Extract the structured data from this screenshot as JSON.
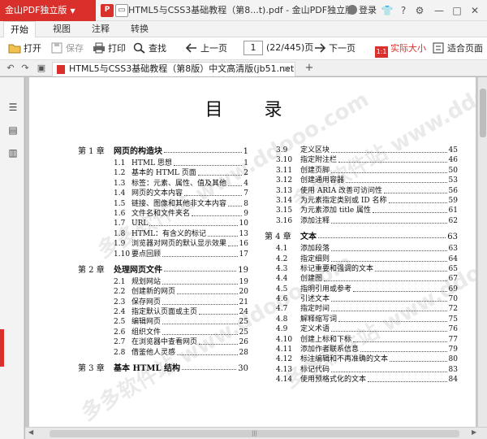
{
  "app": {
    "logo_label": "金山PDF独立版",
    "window_title": "HTML5与CSS3基础教程（第8...t).pdf - 金山PDF独立版",
    "login_label": "登录"
  },
  "menu": [
    "开始",
    "视图",
    "注释",
    "转换"
  ],
  "toolbar": {
    "open": "打开",
    "save": "保存",
    "print": "打印",
    "find": "查找",
    "prev_page": "上一页",
    "page_value": "1",
    "page_count": "(22/445)页",
    "next_page": "下一页",
    "actual_size": "实际大小",
    "fit_page": "适合页面"
  },
  "doc_tab": {
    "label": "HTML5与CSS3基础教程（第8版）中文高清版(jb51.net).pdf"
  },
  "page": {
    "title": "目 录",
    "watermark": "多多软件站 www.ddooo.com",
    "left_column": [
      {
        "type": "chapter",
        "num": "第 1 章",
        "text": "网页的构造块",
        "page": "1"
      },
      {
        "type": "entry",
        "num": "1.1",
        "text": "HTML 思想",
        "page": "1"
      },
      {
        "type": "entry",
        "num": "1.2",
        "text": "基本的 HTML 页面",
        "page": "2"
      },
      {
        "type": "entry",
        "num": "1.3",
        "text": "标签：元素、属性、值及其他",
        "page": "4"
      },
      {
        "type": "entry",
        "num": "1.4",
        "text": "网页的文本内容",
        "page": "7"
      },
      {
        "type": "entry",
        "num": "1.5",
        "text": "链接、图像和其他非文本内容",
        "page": "8"
      },
      {
        "type": "entry",
        "num": "1.6",
        "text": "文件名和文件夹名",
        "page": "9"
      },
      {
        "type": "entry",
        "num": "1.7",
        "text": "URL",
        "page": "10"
      },
      {
        "type": "entry",
        "num": "1.8",
        "text": "HTML：有含义的标记",
        "page": "13"
      },
      {
        "type": "entry",
        "num": "1.9",
        "text": "浏览器对网页的默认显示效果",
        "page": "16"
      },
      {
        "type": "entry",
        "num": "1.10",
        "text": "要点回顾",
        "page": "17"
      },
      {
        "type": "chapter",
        "num": "第 2 章",
        "text": "处理网页文件",
        "page": "19"
      },
      {
        "type": "entry",
        "num": "2.1",
        "text": "规划网站",
        "page": "19"
      },
      {
        "type": "entry",
        "num": "2.2",
        "text": "创建新的网页",
        "page": "20"
      },
      {
        "type": "entry",
        "num": "2.3",
        "text": "保存网页",
        "page": "21"
      },
      {
        "type": "entry",
        "num": "2.4",
        "text": "指定默认页面或主页",
        "page": "24"
      },
      {
        "type": "entry",
        "num": "2.5",
        "text": "编辑网页",
        "page": "25"
      },
      {
        "type": "entry",
        "num": "2.6",
        "text": "组织文件",
        "page": "25"
      },
      {
        "type": "entry",
        "num": "2.7",
        "text": "在浏览器中查看网页",
        "page": "26"
      },
      {
        "type": "entry",
        "num": "2.8",
        "text": "借鉴他人灵感",
        "page": "28"
      },
      {
        "type": "chapter",
        "num": "第 3 章",
        "text": "基本 HTML 结构",
        "page": "30"
      }
    ],
    "right_column": [
      {
        "type": "entry",
        "num": "3.9",
        "text": "定义区块",
        "page": "45"
      },
      {
        "type": "entry",
        "num": "3.10",
        "text": "指定附注栏",
        "page": "46"
      },
      {
        "type": "entry",
        "num": "3.11",
        "text": "创建页脚",
        "page": "50"
      },
      {
        "type": "entry",
        "num": "3.12",
        "text": "创建通用容器",
        "page": "53"
      },
      {
        "type": "entry",
        "num": "3.13",
        "text": "使用 ARIA 改善可访问性",
        "page": "56"
      },
      {
        "type": "entry",
        "num": "3.14",
        "text": "为元素指定类别或 ID 名称",
        "page": "59"
      },
      {
        "type": "entry",
        "num": "3.15",
        "text": "为元素添加 title 属性",
        "page": "61"
      },
      {
        "type": "entry",
        "num": "3.16",
        "text": "添加注释",
        "page": "62"
      },
      {
        "type": "chapter",
        "num": "第 4 章",
        "text": "文本",
        "page": "63"
      },
      {
        "type": "entry",
        "num": "4.1",
        "text": "添加段落",
        "page": "63"
      },
      {
        "type": "entry",
        "num": "4.2",
        "text": "指定细则",
        "page": "64"
      },
      {
        "type": "entry",
        "num": "4.3",
        "text": "标记重要和强调的文本",
        "page": "65"
      },
      {
        "type": "entry",
        "num": "4.4",
        "text": "创建图",
        "page": "67"
      },
      {
        "type": "entry",
        "num": "4.5",
        "text": "指明引用或参考",
        "page": "69"
      },
      {
        "type": "entry",
        "num": "4.6",
        "text": "引述文本",
        "page": "70"
      },
      {
        "type": "entry",
        "num": "4.7",
        "text": "指定时间",
        "page": "72"
      },
      {
        "type": "entry",
        "num": "4.8",
        "text": "解释缩写词",
        "page": "75"
      },
      {
        "type": "entry",
        "num": "4.9",
        "text": "定义术语",
        "page": "76"
      },
      {
        "type": "entry",
        "num": "4.10",
        "text": "创建上标和下标",
        "page": "77"
      },
      {
        "type": "entry",
        "num": "4.11",
        "text": "添加作者联系信息",
        "page": "79"
      },
      {
        "type": "entry",
        "num": "4.12",
        "text": "标注编辑和不再准确的文本",
        "page": "80"
      },
      {
        "type": "entry",
        "num": "4.13",
        "text": "标记代码",
        "page": "83"
      },
      {
        "type": "entry",
        "num": "4.14",
        "text": "使用预格式化的文本",
        "page": "84"
      }
    ]
  },
  "colors": {
    "brand": "#d9302c",
    "toolbar_bg": "#f3f3f3",
    "doc_bg": "#c8c8c8"
  }
}
